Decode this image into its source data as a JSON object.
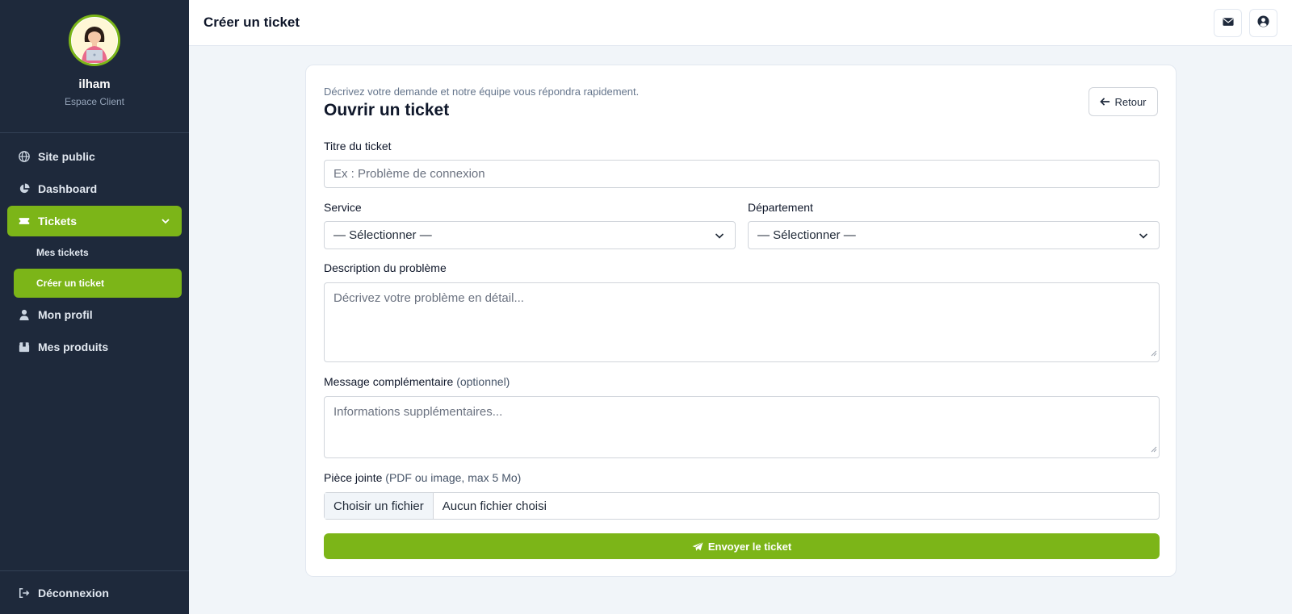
{
  "colors": {
    "sidebar_bg": "#1e293b",
    "accent": "#7cb518",
    "page_bg": "#f1f5f9"
  },
  "user": {
    "name": "ilham",
    "role": "Espace Client"
  },
  "sidebar": {
    "items": [
      {
        "label": "Site public",
        "icon": "globe-icon"
      },
      {
        "label": "Dashboard",
        "icon": "pie-chart-icon"
      },
      {
        "label": "Tickets",
        "icon": "ticket-icon"
      },
      {
        "label": "Mon profil",
        "icon": "user-icon"
      },
      {
        "label": "Mes produits",
        "icon": "box-icon"
      }
    ],
    "sub_items": [
      {
        "label": "Mes tickets"
      },
      {
        "label": "Créer un ticket"
      }
    ],
    "logout_label": "Déconnexion"
  },
  "topbar": {
    "title": "Créer un ticket",
    "icons": [
      "envelope-icon",
      "user-circle-icon"
    ]
  },
  "card": {
    "subtitle": "Décrivez votre demande et notre équipe vous répondra rapidement.",
    "title": "Ouvrir un ticket",
    "back_label": "Retour"
  },
  "form": {
    "title_label": "Titre du ticket",
    "title_placeholder": "Ex : Problème de connexion",
    "service_label": "Service",
    "service_value": "— Sélectionner —",
    "department_label": "Département",
    "department_value": "— Sélectionner —",
    "description_label": "Description du problème",
    "description_placeholder": "Décrivez votre problème en détail...",
    "message_label": "Message complémentaire",
    "message_hint": "(optionnel)",
    "message_placeholder": "Informations supplémentaires...",
    "attachment_label": "Pièce jointe",
    "attachment_hint": "(PDF ou image, max 5 Mo)",
    "file_button": "Choisir un fichier",
    "file_status": "Aucun fichier choisi",
    "submit_label": "Envoyer le ticket"
  }
}
